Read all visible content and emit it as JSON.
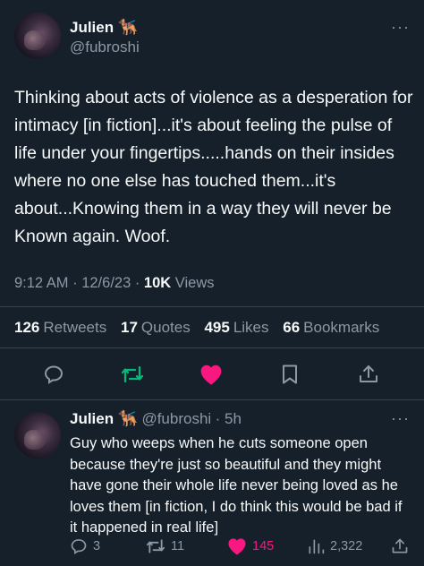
{
  "main_tweet": {
    "author_name": "Julien",
    "author_emoji": "🐕‍🦺",
    "author_handle": "@fubroshi",
    "more_label": "···",
    "text": "Thinking about acts of violence as a desperation for intimacy [in fiction]...it's about feeling the pulse of life under your fingertips.....hands on their insides where no one else has touched them...it's about...Knowing them in a way they will never be Known again. Woof.",
    "time": "9:12 AM · 12/6/23 · ",
    "views_count": "10K",
    "views_label": "Views",
    "stats": {
      "retweets_count": "126",
      "retweets_label": "Retweets",
      "quotes_count": "17",
      "quotes_label": "Quotes",
      "likes_count": "495",
      "likes_label": "Likes",
      "bookmarks_count": "66",
      "bookmarks_label": "Bookmarks"
    }
  },
  "reply": {
    "author_name": "Julien",
    "author_emoji": "🐕‍🦺",
    "author_handle": "@fubroshi",
    "time": "· 5h",
    "more_label": "···",
    "text": "Guy who weeps when he cuts someone open because they're just so beautiful and they might have gone their whole life never being loved as he loves them [in fiction, I do think this would be bad if it happened in real life]",
    "replies": "3",
    "retweets": "11",
    "likes": "145",
    "views": "2,322"
  },
  "icons": {
    "reply": "speech-bubble",
    "retweet": "retweet-arrows",
    "like": "heart",
    "bookmark": "bookmark",
    "share": "share-upload",
    "views": "bar-chart"
  },
  "colors": {
    "background": "#15202b",
    "text": "#f7f9f9",
    "secondary_text": "#8b98a5",
    "retweet_green": "#00ba7c",
    "like_pink": "#f91880",
    "divider": "#38444d"
  }
}
